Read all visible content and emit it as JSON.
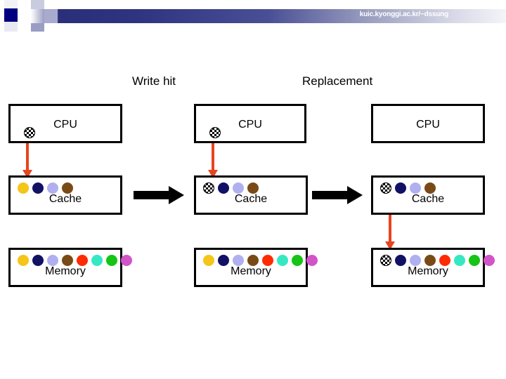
{
  "header": {
    "url": "kuic.kyonggi.ac.kr/~dssung",
    "banner_color": "#2b2f7a",
    "accent_square_color": "#000080"
  },
  "titles": {
    "write_hit": "Write hit",
    "replacement": "Replacement"
  },
  "labels": {
    "cpu": "CPU",
    "cache": "Cache",
    "memory": "Memory"
  },
  "palette": {
    "gold": "#f5c518",
    "navy": "#111166",
    "lavender": "#b0b0f0",
    "brown": "#7a4a16",
    "red": "#ff2b00",
    "turquoise": "#35e8c3",
    "green": "#16c416",
    "orchid": "#d155c9",
    "checker": "checker",
    "arrow_red": "#e8441f",
    "arrow_black": "#000000",
    "box_border": "#000000"
  },
  "columns": [
    {
      "name": "stage-1-write-hit",
      "title": "Write hit",
      "cpu": {
        "label": "CPU",
        "marker": "checker",
        "dots": []
      },
      "cache": {
        "label": "Cache",
        "dots": [
          "gold",
          "navy",
          "lavender",
          "brown"
        ]
      },
      "memory": {
        "label": "Memory",
        "dots": [
          "gold",
          "navy",
          "lavender",
          "brown",
          "red",
          "turquoise",
          "green",
          "orchid"
        ]
      },
      "arrow_cpu_to_cache": true,
      "arrow_cache_to_memory": false
    },
    {
      "name": "stage-2-replacement",
      "title": "Replacement",
      "cpu": {
        "label": "CPU",
        "marker": "checker",
        "dots": []
      },
      "cache": {
        "label": "Cache",
        "dots": [
          "checker",
          "navy",
          "lavender",
          "brown"
        ]
      },
      "memory": {
        "label": "Memory",
        "dots": [
          "gold",
          "navy",
          "lavender",
          "brown",
          "red",
          "turquoise",
          "green",
          "orchid"
        ]
      },
      "arrow_cpu_to_cache": true,
      "arrow_cache_to_memory": false
    },
    {
      "name": "stage-3-writeback",
      "title": "",
      "cpu": {
        "label": "CPU",
        "marker": "none",
        "dots": []
      },
      "cache": {
        "label": "Cache",
        "dots": [
          "checker",
          "navy",
          "lavender",
          "brown"
        ]
      },
      "memory": {
        "label": "Memory",
        "dots": [
          "checker",
          "navy",
          "lavender",
          "brown",
          "red",
          "turquoise",
          "green",
          "orchid"
        ]
      },
      "arrow_cpu_to_cache": false,
      "arrow_cache_to_memory": true
    }
  ],
  "transitions": [
    {
      "name": "transition-1-to-2",
      "kind": "black-right-arrow"
    },
    {
      "name": "transition-2-to-3",
      "kind": "black-right-arrow"
    }
  ]
}
